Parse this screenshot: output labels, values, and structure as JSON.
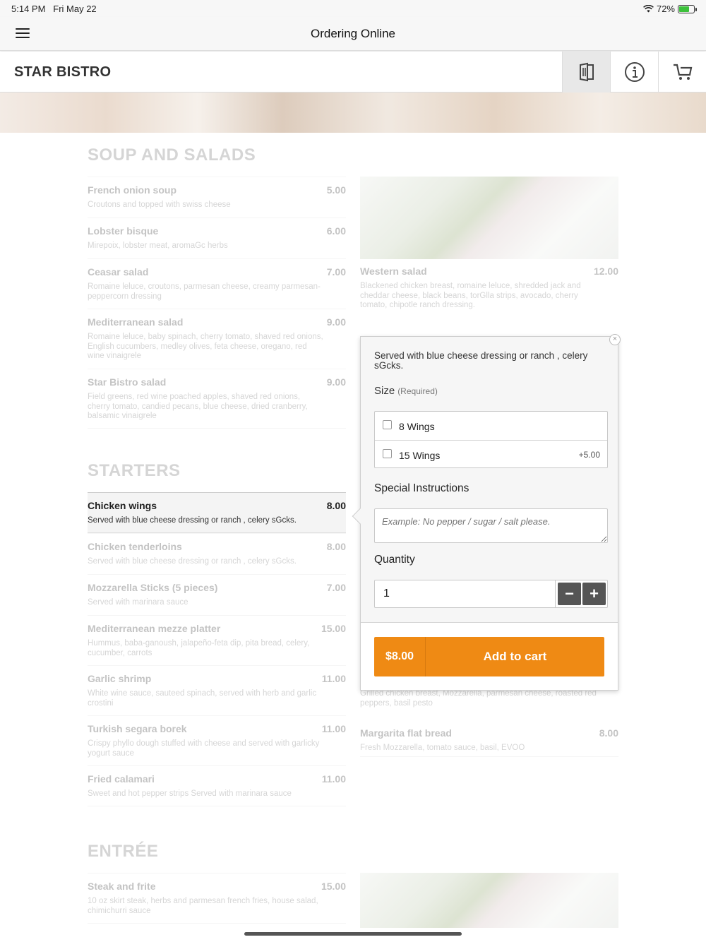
{
  "status": {
    "time": "5:14 PM",
    "date": "Fri May 22",
    "battery": "72%",
    "battery_level": 0.72
  },
  "nav": {
    "title": "Ordering Online"
  },
  "header": {
    "brand": "STAR BISTRO"
  },
  "sections": {
    "soup": {
      "title": "SOUP AND SALADS",
      "left": [
        {
          "name": "French onion soup",
          "price": "5.00",
          "desc": "Croutons and topped with swiss cheese"
        },
        {
          "name": "Lobster bisque",
          "price": "6.00",
          "desc": "Mirepoix, lobster meat, aromaGc herbs"
        },
        {
          "name": "Ceasar salad",
          "price": "7.00",
          "desc": "Romaine leluce, croutons, parmesan cheese, creamy parmesan-peppercorn dressing"
        },
        {
          "name": "Mediterranean salad",
          "price": "9.00",
          "desc": "Romaine leluce, baby spinach, cherry tomato, shaved red onions, English cucumbers, medley olives, feta cheese, oregano, red wine vinaigrele"
        },
        {
          "name": "Star Bistro salad",
          "price": "9.00",
          "desc": "Field greens, red wine poached apples, shaved red onions, cherry tomato, candied pecans, blue cheese, dried cranberry, balsamic vinaigrele"
        }
      ],
      "right": [
        {
          "name": "Western salad",
          "price": "12.00",
          "desc": "Blackened chicken breast, romaine leluce, shredded jack and cheddar cheese, black beans, torGlla strips, avocado, cherry tomato, chipotle ranch dressing."
        }
      ]
    },
    "starters": {
      "title": "STARTERS",
      "left": [
        {
          "name": "Chicken wings",
          "price": "8.00",
          "desc": "Served with blue cheese dressing or ranch , celery sGcks."
        },
        {
          "name": "Chicken tenderloins",
          "price": "8.00",
          "desc": "Served with blue cheese dressing or ranch , celery sGcks."
        },
        {
          "name": "Mozzarella Sticks (5 pieces)",
          "price": "7.00",
          "desc": "Served with marinara sauce"
        },
        {
          "name": "Mediterranean mezze platter",
          "price": "15.00",
          "desc": "Hummus, baba-ganoush, jalapeño-feta dip, pita bread, celery, cucumber, carrots"
        },
        {
          "name": "Garlic shrimp",
          "price": "11.00",
          "desc": "White wine sauce, sauteed spinach, served with herb and garlic crostini"
        },
        {
          "name": "Turkish segara borek",
          "price": "11.00",
          "desc": "Crispy phyllo dough stuffed with cheese and served with garlicky yogurt sauce"
        },
        {
          "name": "Fried calamari",
          "price": "11.00",
          "desc": "Sweet and hot pepper strips Served with marinara sauce"
        }
      ],
      "right": [
        {
          "name": "",
          "price": "",
          "desc": "Grilled chicken breast, Mozzarella, parmesan cheese, roasted red peppers, basil pesto"
        },
        {
          "name": "Margarita flat bread",
          "price": "8.00",
          "desc": "Fresh Mozzarella, tomato sauce, basil, EVOO"
        }
      ]
    },
    "entree": {
      "title": "ENTRÉE",
      "left": [
        {
          "name": "Steak and frite",
          "price": "15.00",
          "desc": "10 oz skirt steak, herbs and parmesan french fries, house salad, chimichurri sauce"
        }
      ]
    }
  },
  "popover": {
    "desc": "Served with blue cheese dressing or ranch , celery sGcks.",
    "size_label": "Size",
    "size_required": "(Required)",
    "options": [
      {
        "label": "8 Wings",
        "price": ""
      },
      {
        "label": "15 Wings",
        "price": "+5.00"
      }
    ],
    "special_label": "Special Instructions",
    "special_placeholder": "Example: No pepper / sugar / salt please.",
    "quantity_label": "Quantity",
    "quantity": "1",
    "minus": "−",
    "plus": "+",
    "total": "$8.00",
    "add_label": "Add to cart",
    "close": "×"
  },
  "colors": {
    "accent": "#ef8a14",
    "stepper": "#555555"
  }
}
